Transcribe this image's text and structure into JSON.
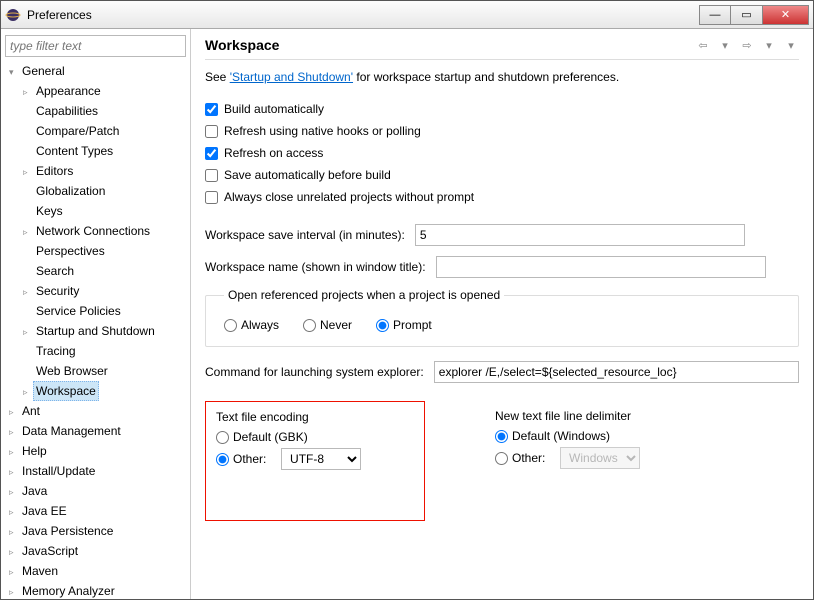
{
  "window": {
    "title": "Preferences"
  },
  "sidebar": {
    "filter_placeholder": "type filter text",
    "tree": {
      "general": "General",
      "general_children": {
        "appearance": "Appearance",
        "capabilities": "Capabilities",
        "compare_patch": "Compare/Patch",
        "content_types": "Content Types",
        "editors": "Editors",
        "globalization": "Globalization",
        "keys": "Keys",
        "network_connections": "Network Connections",
        "perspectives": "Perspectives",
        "search": "Search",
        "security": "Security",
        "service_policies": "Service Policies",
        "startup_shutdown": "Startup and Shutdown",
        "tracing": "Tracing",
        "web_browser": "Web Browser",
        "workspace": "Workspace"
      },
      "ant": "Ant",
      "data_management": "Data Management",
      "help": "Help",
      "install_update": "Install/Update",
      "java": "Java",
      "java_ee": "Java EE",
      "java_persistence": "Java Persistence",
      "javascript": "JavaScript",
      "maven": "Maven",
      "memory_analyzer": "Memory Analyzer"
    }
  },
  "page": {
    "title": "Workspace",
    "intro_prefix": "See ",
    "intro_link": "'Startup and Shutdown'",
    "intro_suffix": " for workspace startup and shutdown preferences.",
    "checks": {
      "build_auto": "Build automatically",
      "refresh_native": "Refresh using native hooks or polling",
      "refresh_access": "Refresh on access",
      "save_before_build": "Save automatically before build",
      "close_unrelated": "Always close unrelated projects without prompt"
    },
    "save_interval_label": "Workspace save interval (in minutes):",
    "save_interval_value": "5",
    "ws_name_label": "Workspace name (shown in window title):",
    "ws_name_value": "",
    "open_ref_title": "Open referenced projects when a project is opened",
    "radio_always": "Always",
    "radio_never": "Never",
    "radio_prompt": "Prompt",
    "cmd_label": "Command for launching system explorer:",
    "cmd_value": "explorer /E,/select=${selected_resource_loc}",
    "enc_title": "Text file encoding",
    "enc_default": "Default (GBK)",
    "enc_other": "Other:",
    "enc_value": "UTF-8",
    "ld_title": "New text file line delimiter",
    "ld_default": "Default (Windows)",
    "ld_other": "Other:",
    "ld_value": "Windows"
  }
}
